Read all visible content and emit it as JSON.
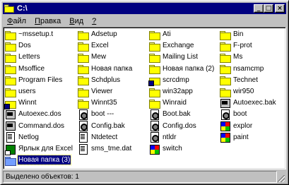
{
  "window": {
    "title": "C:\\",
    "buttons": {
      "minimize": "_",
      "maximize": "□",
      "close": "×"
    }
  },
  "menu": [
    {
      "pre": "",
      "accel": "Ф",
      "post": "айл"
    },
    {
      "pre": "",
      "accel": "П",
      "post": "равка"
    },
    {
      "pre": "",
      "accel": "В",
      "post": "ид"
    },
    {
      "pre": "",
      "accel": "?",
      "post": ""
    }
  ],
  "columns": [
    [
      {
        "label": "~mssetup.t",
        "icon": "folder-icon"
      },
      {
        "label": "Dos",
        "icon": "folder-icon"
      },
      {
        "label": "Letters",
        "icon": "folder-icon"
      },
      {
        "label": "Msoffice",
        "icon": "folder-icon"
      },
      {
        "label": "Program Files",
        "icon": "folder-icon"
      },
      {
        "label": "users",
        "icon": "folder-icon"
      },
      {
        "label": "Winnt",
        "icon": "folder-special-icon"
      },
      {
        "label": "Autoexec.dos",
        "icon": "batch-icon"
      },
      {
        "label": "Command.dos",
        "icon": "batch-icon"
      },
      {
        "label": "Netlog",
        "icon": "file-icon"
      },
      {
        "label": "Ярлык для Excel",
        "icon": "excel-shortcut-icon"
      },
      {
        "label": "Новая папка (3)",
        "icon": "folder-icon",
        "selected": true
      }
    ],
    [
      {
        "label": "Adsetup",
        "icon": "folder-icon"
      },
      {
        "label": "Excel",
        "icon": "folder-icon"
      },
      {
        "label": "Mew",
        "icon": "folder-icon"
      },
      {
        "label": "Новая папка",
        "icon": "folder-icon"
      },
      {
        "label": "Schdplus",
        "icon": "folder-icon"
      },
      {
        "label": "Viewer",
        "icon": "folder-icon"
      },
      {
        "label": "Winnt35",
        "icon": "folder-icon"
      },
      {
        "label": "boot ---",
        "icon": "config-icon"
      },
      {
        "label": "Config.bak",
        "icon": "config-icon"
      },
      {
        "label": "Ntdetect",
        "icon": "file-icon"
      },
      {
        "label": "sms_tme.dat",
        "icon": "file-icon"
      }
    ],
    [
      {
        "label": "Ati",
        "icon": "folder-icon"
      },
      {
        "label": "Exchange",
        "icon": "folder-icon"
      },
      {
        "label": "Mailing List",
        "icon": "folder-icon"
      },
      {
        "label": "Новая папка (2)",
        "icon": "folder-icon"
      },
      {
        "label": "scrcdmp",
        "icon": "folder-special-icon"
      },
      {
        "label": "win32app",
        "icon": "folder-icon"
      },
      {
        "label": "Winraid",
        "icon": "folder-icon"
      },
      {
        "label": "Boot.bak",
        "icon": "config-icon"
      },
      {
        "label": "Config.dos",
        "icon": "config-icon"
      },
      {
        "label": "ntldr",
        "icon": "config-icon"
      },
      {
        "label": "switch",
        "icon": "app-icon"
      }
    ],
    [
      {
        "label": "Bin",
        "icon": "folder-icon"
      },
      {
        "label": "F-prot",
        "icon": "folder-icon"
      },
      {
        "label": "Ms",
        "icon": "folder-icon"
      },
      {
        "label": "nsamcmp",
        "icon": "folder-icon"
      },
      {
        "label": "Technet",
        "icon": "folder-icon"
      },
      {
        "label": "wir950",
        "icon": "folder-icon"
      },
      {
        "label": "Autoexec.bak",
        "icon": "batch-icon"
      },
      {
        "label": "boot",
        "icon": "config-icon"
      },
      {
        "label": "explor",
        "icon": "app-icon"
      },
      {
        "label": "paint",
        "icon": "app-icon"
      }
    ]
  ],
  "status": {
    "text": "Выделено объектов: 1"
  }
}
